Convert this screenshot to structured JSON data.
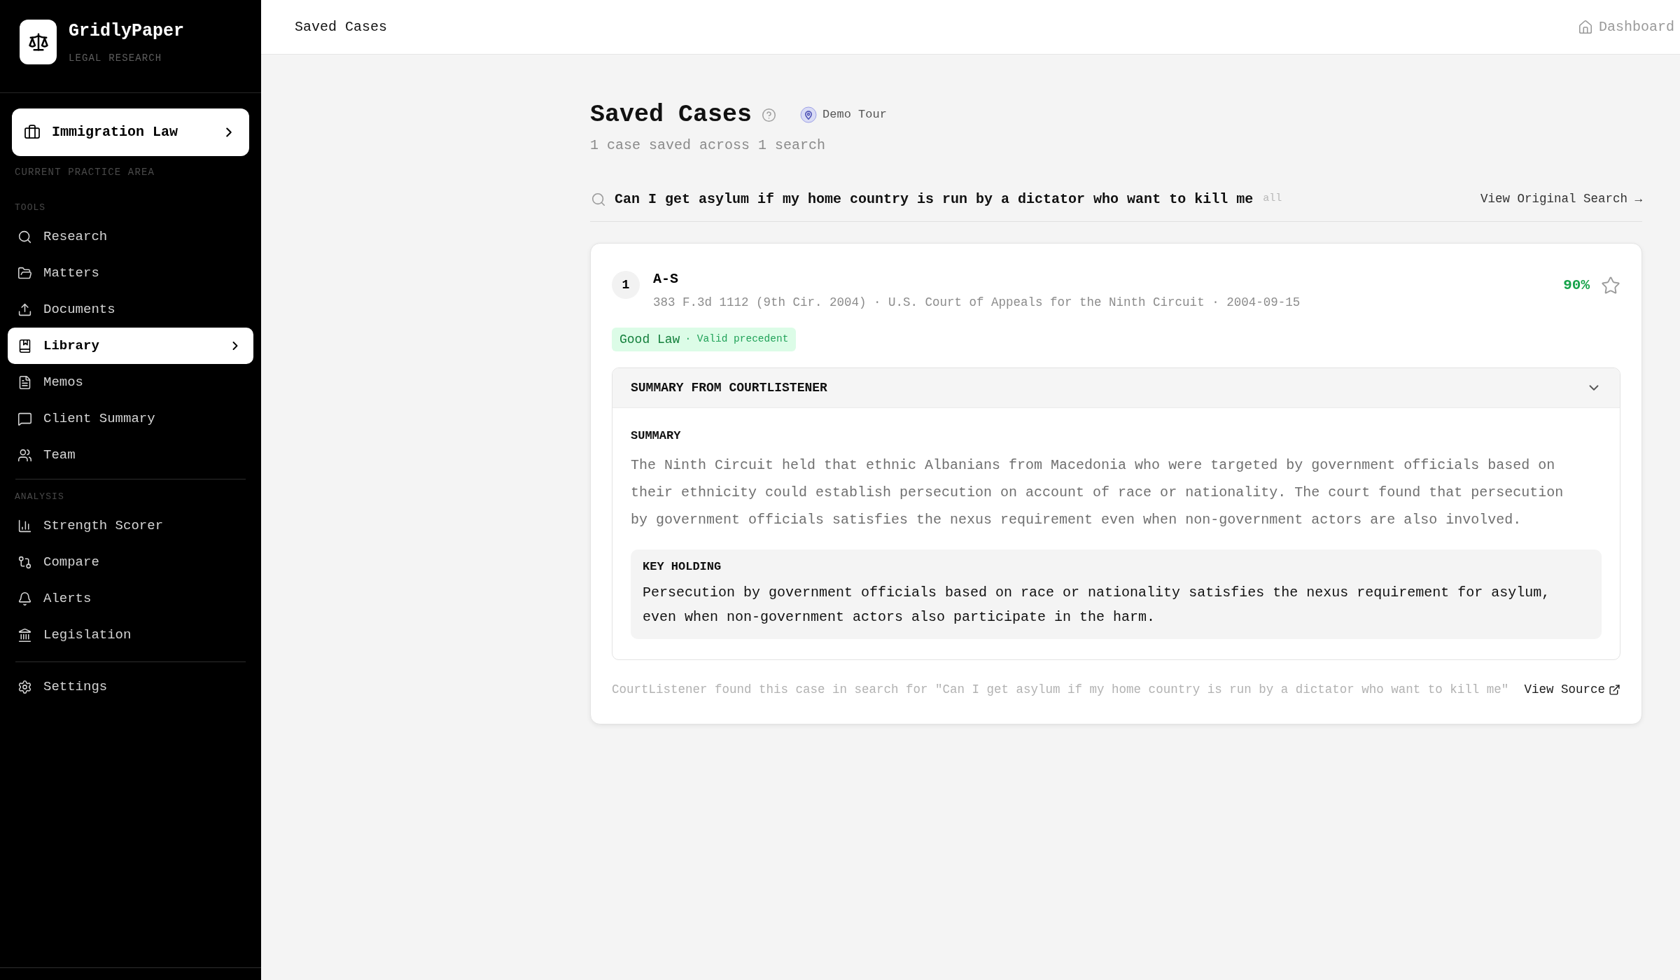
{
  "sidebar": {
    "brand": {
      "name": "GridlyPaper",
      "tagline": "LEGAL RESEARCH"
    },
    "practice_area": {
      "name": "Immigration Law",
      "caption": "CURRENT PRACTICE AREA"
    },
    "sections": [
      {
        "heading": "TOOLS",
        "items": [
          {
            "label": "Research",
            "selected": false
          },
          {
            "label": "Matters",
            "selected": false
          },
          {
            "label": "Documents",
            "selected": false
          },
          {
            "label": "Library",
            "selected": true
          },
          {
            "label": "Memos",
            "selected": false
          },
          {
            "label": "Client Summary",
            "selected": false
          },
          {
            "label": "Team",
            "selected": false
          }
        ]
      },
      {
        "heading": "ANALYSIS",
        "items": [
          {
            "label": "Strength Scorer",
            "selected": false
          },
          {
            "label": "Compare",
            "selected": false
          },
          {
            "label": "Alerts",
            "selected": false
          },
          {
            "label": "Legislation",
            "selected": false
          }
        ]
      },
      {
        "items": [
          {
            "label": "Settings",
            "selected": false
          }
        ]
      }
    ]
  },
  "header": {
    "title": "Saved Cases",
    "link": "Dashboard"
  },
  "page": {
    "title": "Saved Cases",
    "tour_button": "Demo Tour",
    "subtitle": "1 case saved across 1 search"
  },
  "saved_searches": [
    {
      "query": "Can I get asylum if my home country is run by a dictator who want to kill me",
      "scope": "all",
      "link": "View Original Search →",
      "cases": [
        {
          "rank": "1",
          "name": "A-S",
          "meta": "383 F.3d 1112 (9th Cir. 2004) · U.S. Court of Appeals for the Ninth Circuit · 2004-09-15",
          "score": "90%",
          "starred": false,
          "status": {
            "label": "Good Law",
            "detail": "· Valid precedent"
          },
          "summary_panel": {
            "title": "SUMMARY FROM COURTLISTENER",
            "expanded": true,
            "summary_label": "SUMMARY",
            "summary": "The Ninth Circuit held that ethnic Albanians from Macedonia who were targeted by government officials based on their ethnicity could establish persecution on account of race or nationality. The court found that persecution by government officials satisfies the nexus requirement even when non-government actors are also involved.",
            "holding_label": "KEY HOLDING",
            "holding": "Persecution by government officials based on race or nationality satisfies the nexus requirement for asylum, even when non-government actors also participate in the harm."
          },
          "source_note": "CourtListener found this case in search for \"Can I get asylum if my home country is run by a dictator who want to kill me\"",
          "source_link": "View Source"
        }
      ]
    }
  ]
}
